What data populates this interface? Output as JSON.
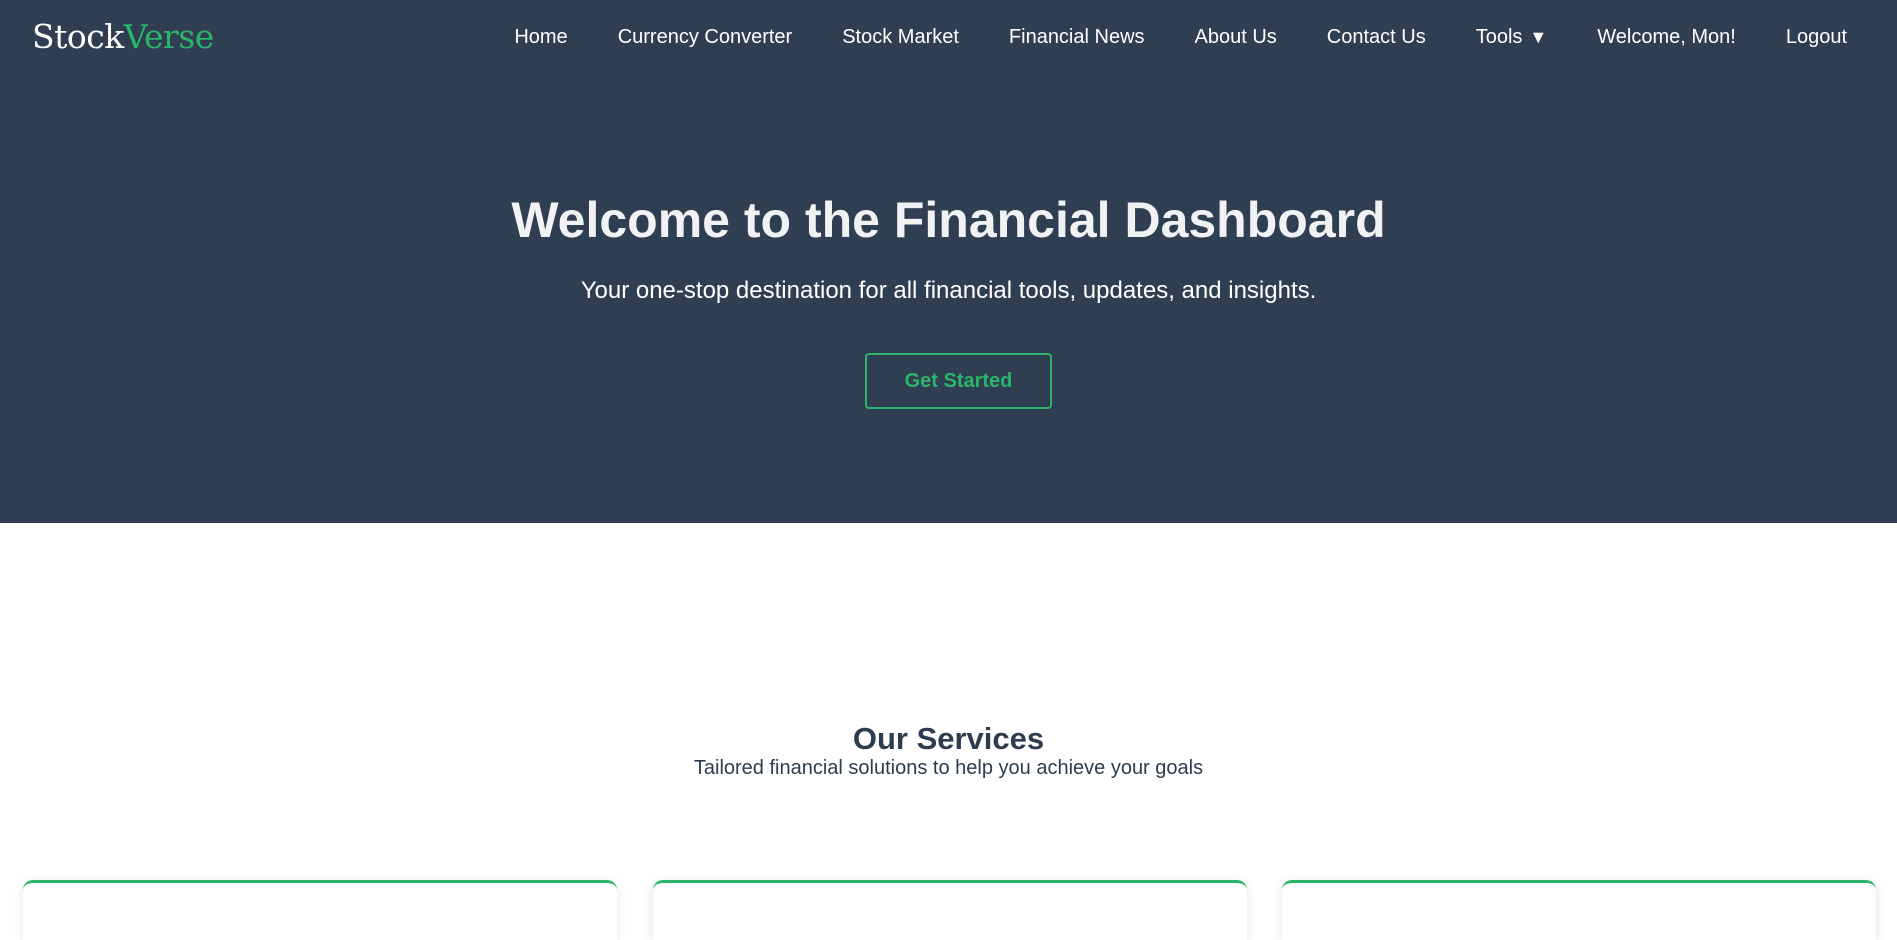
{
  "brand": {
    "logo_part1": "Stock",
    "logo_part2": "Verse",
    "accent_color": "#2ab56b",
    "header_bg": "#2f3e51"
  },
  "nav": {
    "items": [
      {
        "label": "Home"
      },
      {
        "label": "Currency Converter"
      },
      {
        "label": "Stock Market"
      },
      {
        "label": "Financial News"
      },
      {
        "label": "About Us"
      },
      {
        "label": "Contact Us"
      },
      {
        "label": "Tools",
        "icon": "caret-down-icon",
        "caret": "▼"
      },
      {
        "label": "Welcome, Mon!"
      },
      {
        "label": "Logout"
      }
    ]
  },
  "hero": {
    "title": "Welcome to the Financial Dashboard",
    "subtitle": "Your one-stop destination for all financial tools, updates, and insights.",
    "cta_label": "Get Started"
  },
  "services": {
    "title": "Our Services",
    "subtitle": "Tailored financial solutions to help you achieve your goals"
  }
}
